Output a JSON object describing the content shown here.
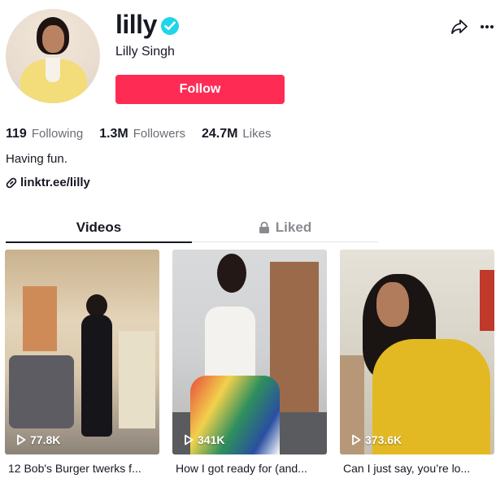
{
  "profile": {
    "username": "lilly",
    "full_name": "Lilly Singh",
    "follow_label": "Follow",
    "bio": "Having fun.",
    "link": "linktr.ee/lilly",
    "verified": true,
    "accent_color": "#fe2c55",
    "verified_color": "#20d5ec"
  },
  "stats": [
    {
      "value": "119",
      "label": "Following"
    },
    {
      "value": "1.3M",
      "label": "Followers"
    },
    {
      "value": "24.7M",
      "label": "Likes"
    }
  ],
  "tabs": [
    {
      "label": "Videos",
      "active": true
    },
    {
      "label": "Liked",
      "active": false,
      "icon": "lock-icon"
    }
  ],
  "videos": [
    {
      "views": "77.8K",
      "caption": "12 Bob's Burger twerks f..."
    },
    {
      "views": "341K",
      "caption": "How I got ready for (and..."
    },
    {
      "views": "373.6K",
      "caption": "Can I just say, you’re lo..."
    }
  ],
  "icons": [
    "share-icon",
    "more-icon",
    "link-icon",
    "lock-icon",
    "play-icon",
    "verified-badge-icon"
  ]
}
